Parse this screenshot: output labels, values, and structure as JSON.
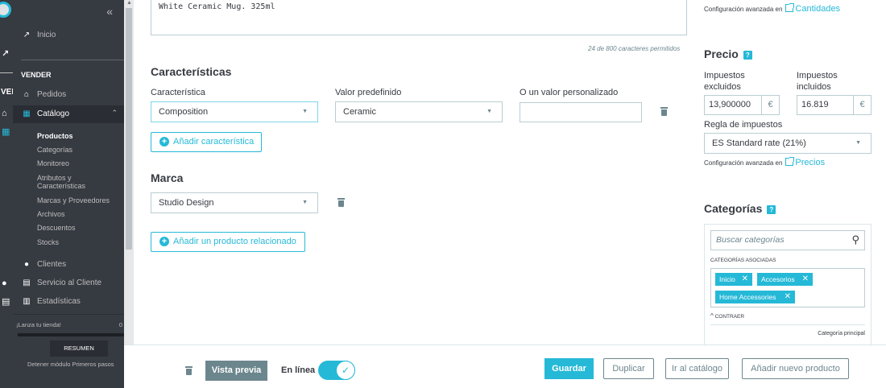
{
  "sidebar": {
    "collapse_icon": "double-chevron-left-icon",
    "home_label": "Inicio",
    "section_title": "VENDER",
    "items": [
      {
        "label": "Pedidos",
        "icon": "shopping-basket-icon"
      },
      {
        "label": "Catálogo",
        "icon": "store-icon"
      },
      {
        "label": "Clientes",
        "icon": "account-circle-icon"
      },
      {
        "label": "Servicio al Cliente",
        "icon": "chat-icon"
      },
      {
        "label": "Estadísticas",
        "icon": "bar-chart-icon"
      }
    ],
    "catalog_sub": [
      "Productos",
      "Categorías",
      "Monitoreo",
      "Atributos y",
      "Características",
      "Marcas y Proveedores",
      "Archivos",
      "Descuentos",
      "Stocks"
    ],
    "launch_label": "¡Lanza tu tienda!",
    "launch_pct": "0",
    "resumen_label": "RESUMEN",
    "stop_label": "Detener módulo Primeros pasos"
  },
  "strip": {
    "icons": [
      "trend-icon",
      "ve-text",
      "basket-icon",
      "store-icon",
      "account-icon",
      "chat-icon"
    ],
    "ve_text": "VEI"
  },
  "description": {
    "text": "White Ceramic Mug. 325ml",
    "counter": "24 de 800 caracteres permitidos"
  },
  "features": {
    "title": "Características",
    "col_feature": "Característica",
    "col_value": "Valor predefinido",
    "col_custom": "O un valor personalizado",
    "feature_value": "Composition",
    "predefined_value": "Ceramic",
    "custom_value": "",
    "add_button": "Añadir característica"
  },
  "brand": {
    "title": "Marca",
    "value": "Studio Design",
    "add_related": "Añadir un producto relacionado"
  },
  "quantities": {
    "advanced_text": "Configuración avanzada en",
    "advanced_link": "Cantidades"
  },
  "price": {
    "title": "Precio",
    "excl_label_1": "Impuestos",
    "excl_label_2": "excluidos",
    "incl_label_1": "Impuestos",
    "incl_label_2": "incluidos",
    "excl_value": "13,900000",
    "incl_value": "16.819",
    "currency": "€",
    "tax_rule_label": "Regla de impuestos",
    "tax_rule_value": "ES Standard rate (21%)",
    "advanced_text": "Configuración avanzada en",
    "advanced_link": "Precios"
  },
  "categories": {
    "title": "Categorías",
    "search_placeholder": "Buscar categorías",
    "associated_label": "CATEGORÍAS ASOCIADAS",
    "tags": [
      "Inicio",
      "Accesorios",
      "Home Accessories"
    ],
    "collapse_label": "CONTRAER",
    "main_category_label": "Categoría principal"
  },
  "footer": {
    "preview": "Vista previa",
    "online_label": "En línea",
    "online": true,
    "save": "Guardar",
    "duplicate": "Duplicar",
    "to_catalog": "Ir al catálogo",
    "add_new": "Añadir nuevo producto"
  },
  "colors": {
    "accent": "#25b9d7",
    "sidebar_bg": "#363a41",
    "text": "#363a41",
    "muted": "#6c868e"
  }
}
